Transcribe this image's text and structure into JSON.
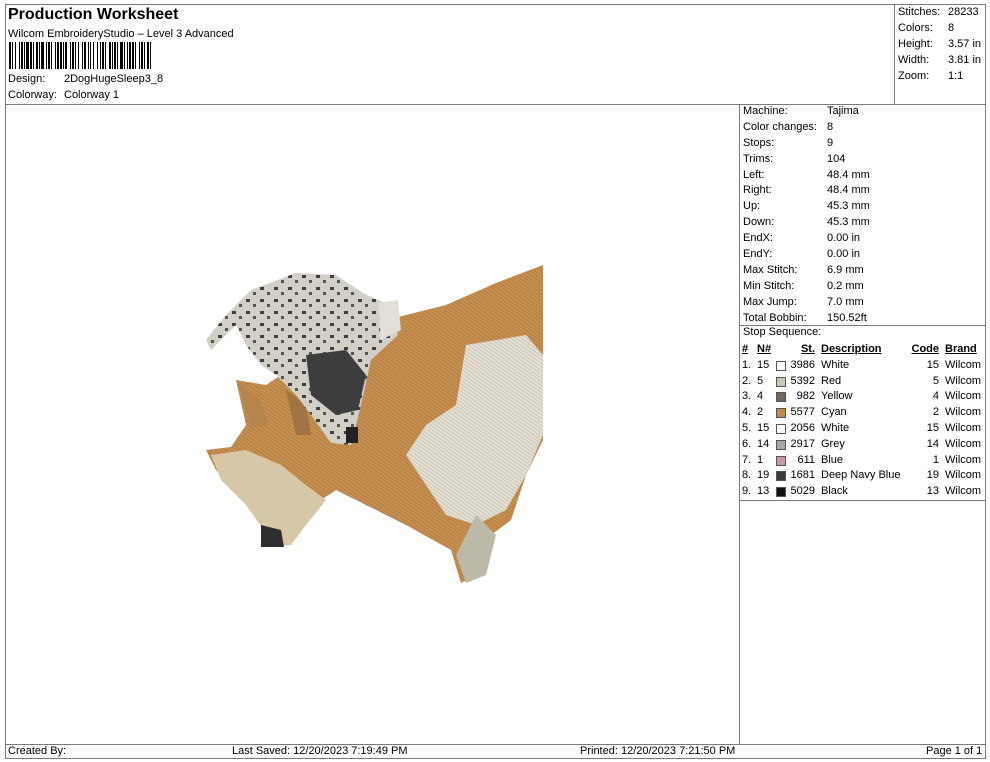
{
  "header": {
    "title": "Production Worksheet",
    "subtitle": "Wilcom EmbroideryStudio – Level 3 Advanced",
    "design_label": "Design:",
    "design_value": "2DogHugeSleep3_8",
    "colorway_label": "Colorway:",
    "colorway_value": "Colorway 1"
  },
  "stats": [
    {
      "label": "Stitches:",
      "value": "28233"
    },
    {
      "label": "Colors:",
      "value": "8"
    },
    {
      "label": "Height:",
      "value": "3.57 in"
    },
    {
      "label": "Width:",
      "value": "3.81 in"
    },
    {
      "label": "Zoom:",
      "value": "1:1"
    }
  ],
  "params": [
    {
      "label": "Machine:",
      "value": "Tajima"
    },
    {
      "label": "Color changes:",
      "value": "8"
    },
    {
      "label": "Stops:",
      "value": "9"
    },
    {
      "label": "Trims:",
      "value": "104"
    },
    {
      "label": "Left:",
      "value": "48.4 mm"
    },
    {
      "label": "Right:",
      "value": "48.4 mm"
    },
    {
      "label": "Up:",
      "value": "45.3 mm"
    },
    {
      "label": "Down:",
      "value": "45.3 mm"
    },
    {
      "label": "EndX:",
      "value": "0.00 in"
    },
    {
      "label": "EndY:",
      "value": "0.00 in"
    },
    {
      "label": "Max Stitch:",
      "value": "6.9 mm"
    },
    {
      "label": "Min Stitch:",
      "value": "0.2 mm"
    },
    {
      "label": "Max Jump:",
      "value": "7.0 mm"
    },
    {
      "label": "Total Bobbin:",
      "value": "150.52ft"
    }
  ],
  "stop_sequence": {
    "label": "Stop Sequence:",
    "headers": {
      "num": "#",
      "n": "N#",
      "st": "St.",
      "desc": "Description",
      "code": "Code",
      "brand": "Brand"
    },
    "rows": [
      {
        "num": "1.",
        "n": "15",
        "color": "#ffffff",
        "st": "3986",
        "desc": "White",
        "code": "15",
        "brand": "Wilcom"
      },
      {
        "num": "2.",
        "n": "5",
        "color": "#c9c6b4",
        "st": "5392",
        "desc": "Red",
        "code": "5",
        "brand": "Wilcom"
      },
      {
        "num": "3.",
        "n": "4",
        "color": "#6e6a5c",
        "st": "982",
        "desc": "Yellow",
        "code": "4",
        "brand": "Wilcom"
      },
      {
        "num": "4.",
        "n": "2",
        "color": "#c28a4a",
        "st": "5577",
        "desc": "Cyan",
        "code": "2",
        "brand": "Wilcom"
      },
      {
        "num": "5.",
        "n": "15",
        "color": "#ffffff",
        "st": "2056",
        "desc": "White",
        "code": "15",
        "brand": "Wilcom"
      },
      {
        "num": "6.",
        "n": "14",
        "color": "#a7a7a7",
        "st": "2917",
        "desc": "Grey",
        "code": "14",
        "brand": "Wilcom"
      },
      {
        "num": "7.",
        "n": "1",
        "color": "#c79aa5",
        "st": "611",
        "desc": "Blue",
        "code": "1",
        "brand": "Wilcom"
      },
      {
        "num": "8.",
        "n": "19",
        "color": "#3a3a3a",
        "st": "1681",
        "desc": "Deep Navy Blue",
        "code": "19",
        "brand": "Wilcom"
      },
      {
        "num": "9.",
        "n": "13",
        "color": "#111111",
        "st": "5029",
        "desc": "Black",
        "code": "13",
        "brand": "Wilcom"
      }
    ]
  },
  "footer": {
    "created_by": "Created By:",
    "last_saved": "Last Saved: 12/20/2023 7:19:49 PM",
    "printed": "Printed: 12/20/2023 7:21:50 PM",
    "page": "Page 1 of 1"
  }
}
